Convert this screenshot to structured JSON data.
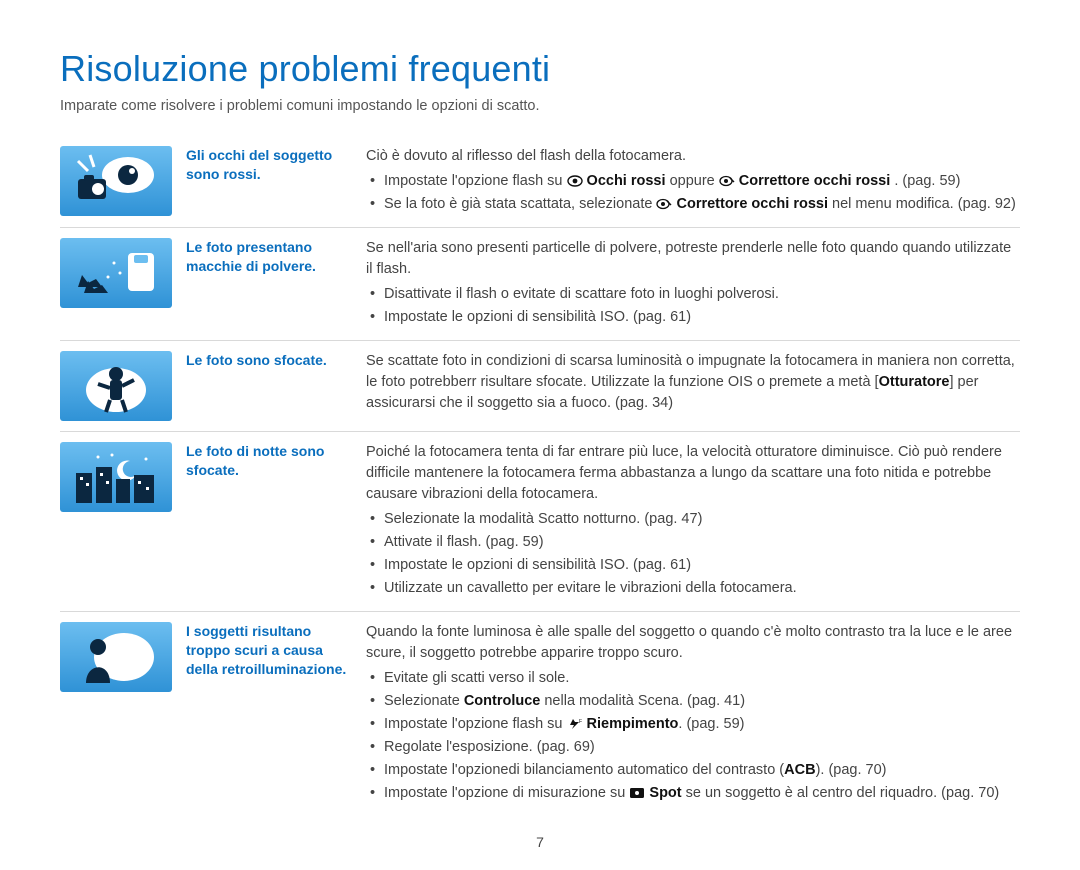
{
  "page": {
    "title": "Risoluzione problemi frequenti",
    "subtitle": "Imparate come risolvere i problemi comuni impostando le opzioni di scatto.",
    "footer_page": "7"
  },
  "sections": [
    {
      "icon": "redeye",
      "label": "Gli occhi del soggetto sono rossi.",
      "intro": "Ciò è dovuto al riflesso del flash della fotocamera.",
      "bullets": [
        {
          "prefix": "Impostate l'opzione flash su ",
          "icon": "eye",
          "bold1": "Occhi rossi",
          "mid": " oppure ",
          "icon2": "eye2",
          "bold2": "Correttore occhi rossi",
          "suffix": ". (pag. 59)"
        },
        {
          "prefix": "Se la foto è già stata scattata, selezionate ",
          "icon": "eye2",
          "bold1": "Correttore occhi rossi",
          "suffix": " nel menu modifica. (pag. 92)"
        }
      ]
    },
    {
      "icon": "dust",
      "label": "Le foto presentano macchie di polvere.",
      "intro": "Se nell'aria sono presenti particelle di polvere, potreste prenderle nelle foto quando quando utilizzate il flash.",
      "bullets": [
        {
          "text": "Disattivate il flash o evitate di scattare foto in luoghi polverosi."
        },
        {
          "text": "Impostate le opzioni di sensibilità ISO. (pag. 61)"
        }
      ]
    },
    {
      "icon": "blur",
      "label": "Le foto sono sfocate.",
      "body_parts": {
        "p1": "Se scattate foto in condizioni di scarsa luminosità o impugnate la fotocamera in maniera non corretta, le foto potrebberr risultare sfocate. Utilizzate la funzione OIS o premete a metà [",
        "shutter": "Otturatore",
        "p2": "] per assicurarsi che il soggetto sia a fuoco. (pag. 34)"
      }
    },
    {
      "icon": "night",
      "label": "Le foto di notte sono sfocate.",
      "intro": "Poiché la fotocamera tenta di far entrare più luce, la velocità otturatore diminuisce. Ciò può rendere difficile mantenere la fotocamera ferma abbastanza a lungo da scattare una foto nitida e potrebbe causare vibrazioni della fotocamera.",
      "bullets": [
        {
          "text": "Selezionate la modalità Scatto notturno. (pag. 47)"
        },
        {
          "text": "Attivate il flash. (pag. 59)"
        },
        {
          "text": "Impostate le opzioni di sensibilità ISO. (pag. 61)"
        },
        {
          "text": "Utilizzate un cavalletto per evitare le vibrazioni della fotocamera."
        }
      ]
    },
    {
      "icon": "backlight",
      "label": "I soggetti risultano troppo scuri a causa della retroilluminazione.",
      "intro": "Quando la fonte luminosa è alle spalle del soggetto o quando c'è molto contrasto tra la luce e le aree scure, il soggetto potrebbe apparire troppo scuro.",
      "bullets": [
        {
          "text": "Evitate gli scatti verso il sole."
        },
        {
          "prefix": "Selezionate ",
          "bold1": "Controluce",
          "suffix": " nella modalità Scena. (pag. 41)"
        },
        {
          "prefix": "Impostate l'opzione flash su ",
          "icon": "flash",
          "bold1": "Riempimento",
          "suffix": ". (pag. 59)"
        },
        {
          "text": "Regolate l'esposizione. (pag. 69)"
        },
        {
          "prefix": "Impostate l'opzionedi bilanciamento automatico del contrasto (",
          "bold1": "ACB",
          "suffix": "). (pag. 70)"
        },
        {
          "prefix": "Impostate l'opzione di misurazione su ",
          "icon": "dot",
          "bold1": "Spot",
          "suffix": " se un soggetto è al centro del riquadro. (pag. 70)"
        }
      ]
    }
  ]
}
